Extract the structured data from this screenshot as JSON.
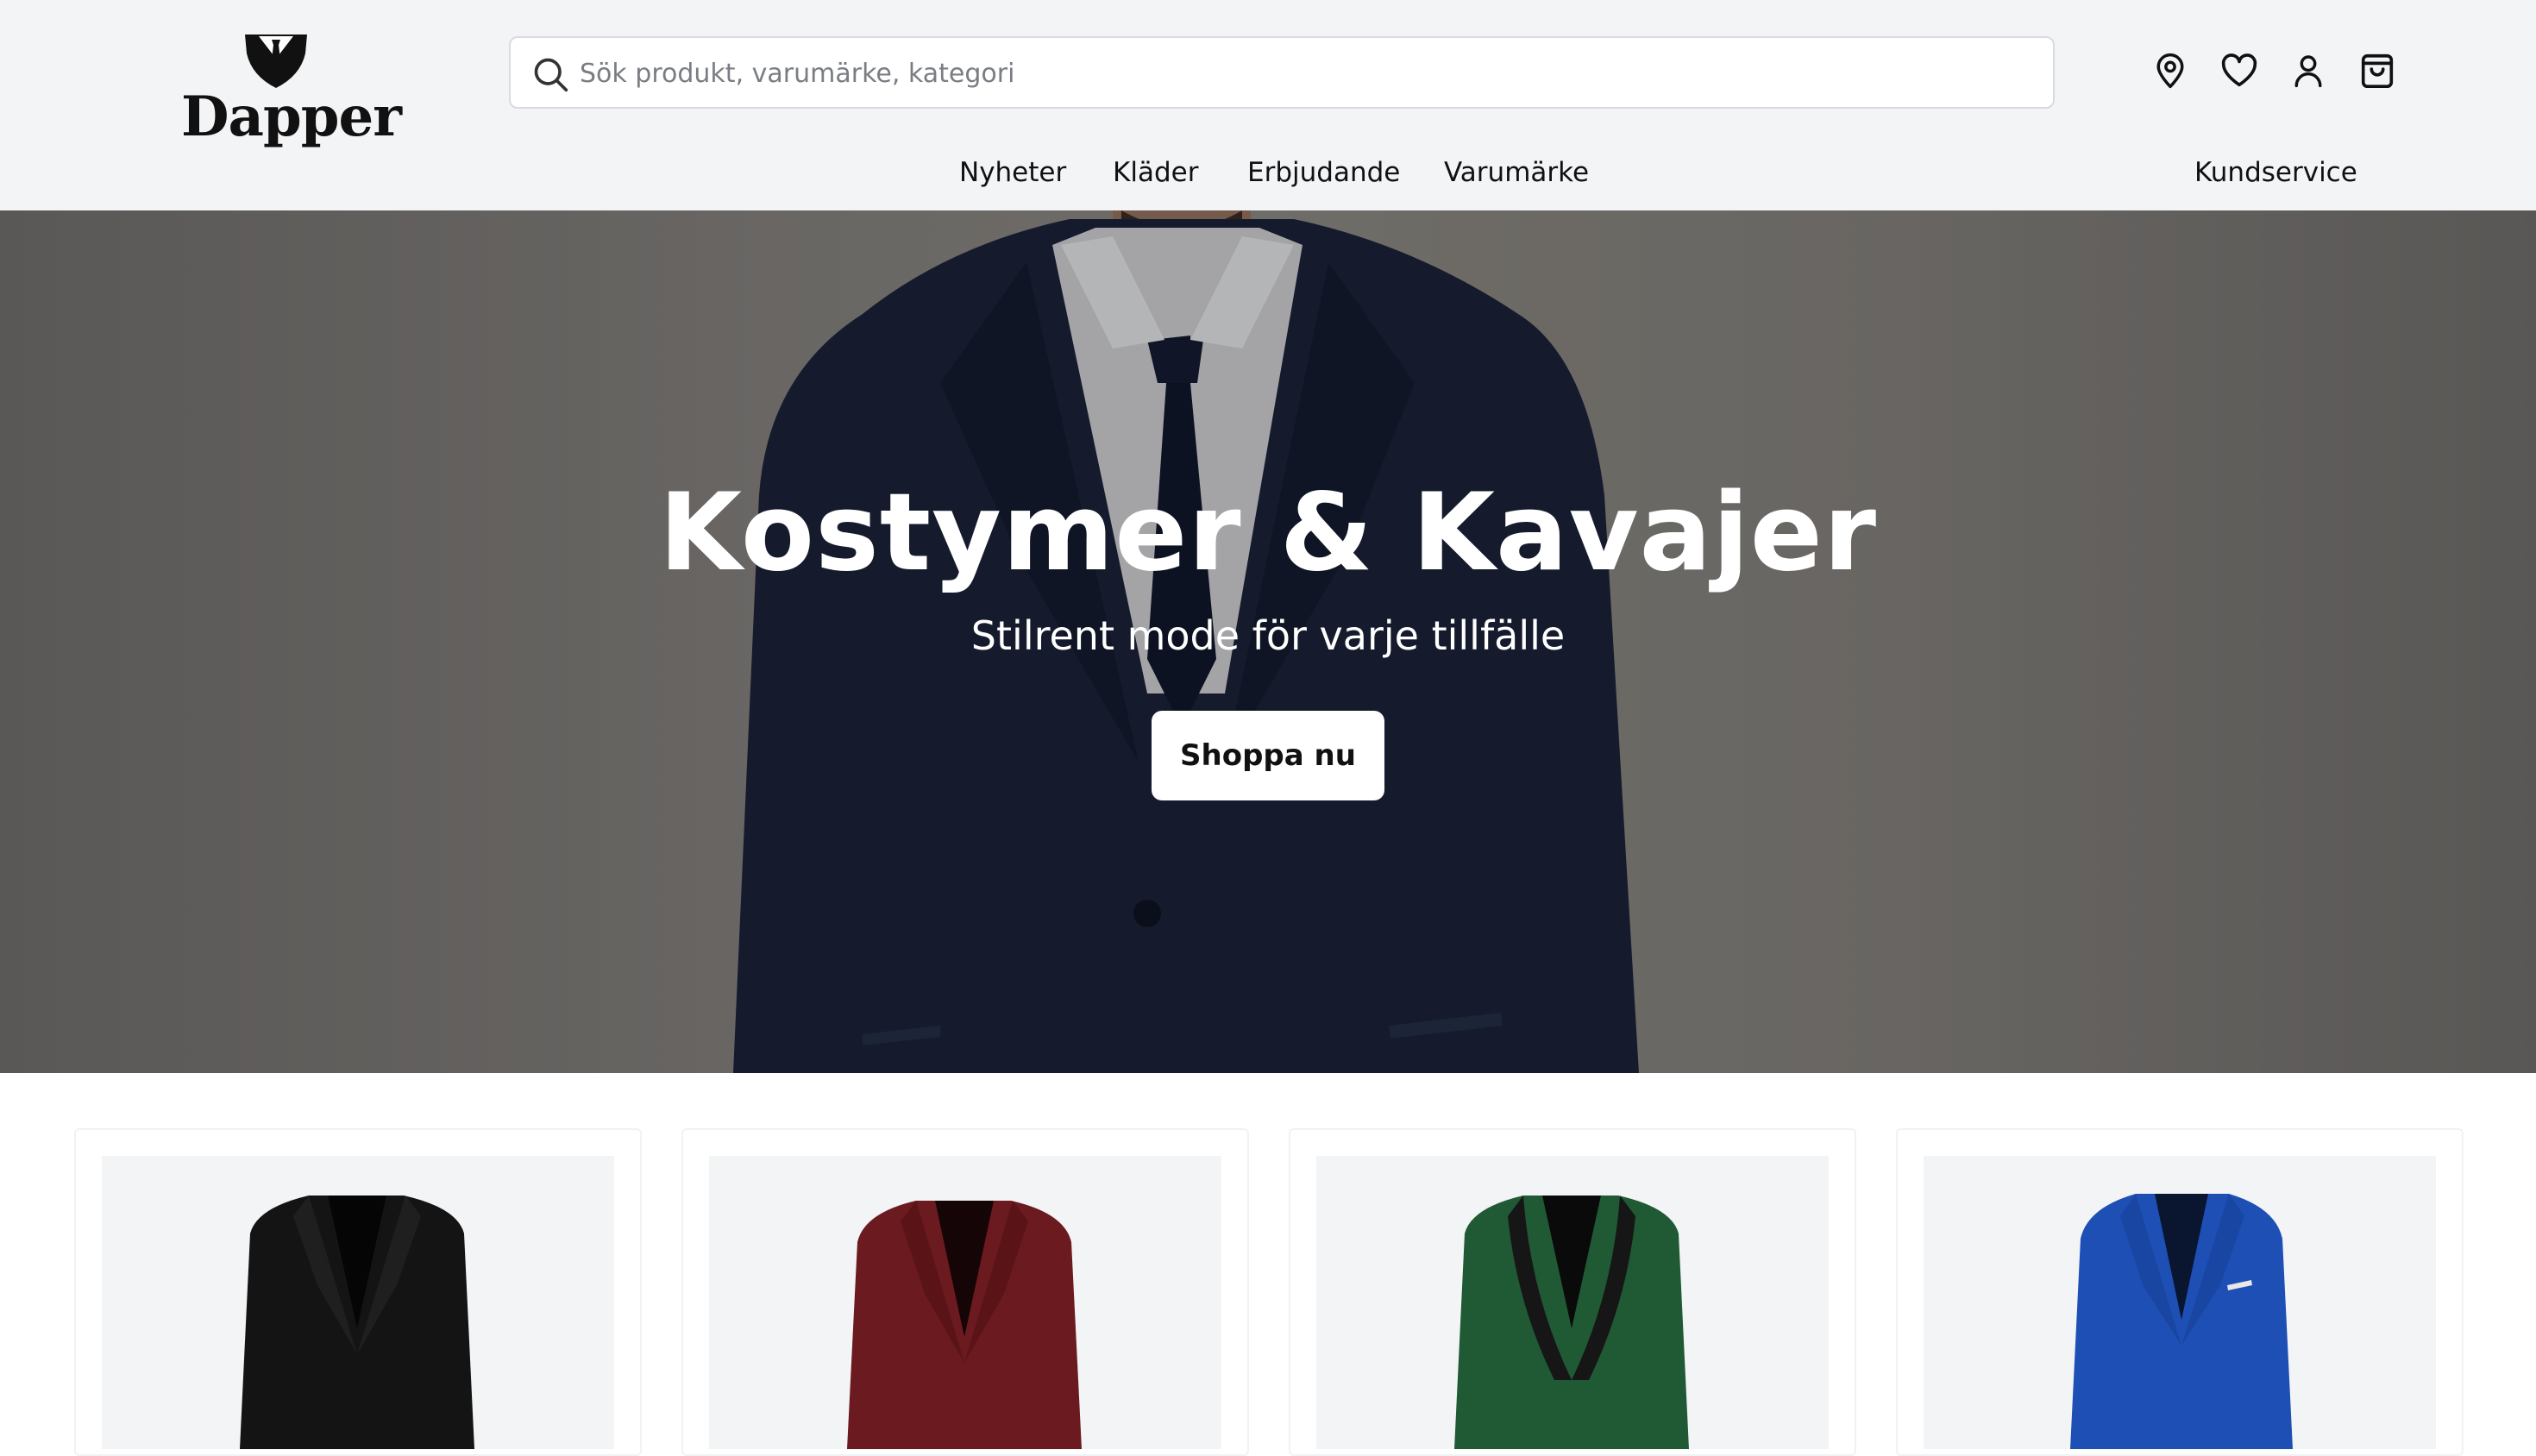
{
  "brand": {
    "name": "Dapper",
    "logo_icon": "suit-shield-icon"
  },
  "search": {
    "placeholder": "Sök produkt, varumärke, kategori",
    "icon": "search-icon"
  },
  "header_icons": [
    "location-pin-icon",
    "heart-icon",
    "user-icon",
    "shopping-bag-icon"
  ],
  "nav": {
    "items": [
      {
        "label": "Nyheter"
      },
      {
        "label": "Kläder"
      },
      {
        "label": "Erbjudande"
      },
      {
        "label": "Varumärke"
      }
    ],
    "service": "Kundservice"
  },
  "hero": {
    "title": "Kostymer & Kavajer",
    "subtitle": "Stilrent mode för varje tillfälle",
    "cta": "Shoppa nu"
  },
  "products": [
    {
      "name": "black-blazer",
      "jacket_color": "#141414",
      "lapel": "notch"
    },
    {
      "name": "burgundy-blazer",
      "jacket_color": "#6b1a1f",
      "lapel": "notch"
    },
    {
      "name": "green-tuxedo-jacket",
      "jacket_color": "#1f5a35",
      "lapel": "shawl-black"
    },
    {
      "name": "blue-blazer",
      "jacket_color": "#1d4fb5",
      "lapel": "notch"
    }
  ],
  "colors": {
    "header_bg": "#f3f4f6",
    "hero_bg": "#7d7a76",
    "suit": "#1a2238"
  }
}
